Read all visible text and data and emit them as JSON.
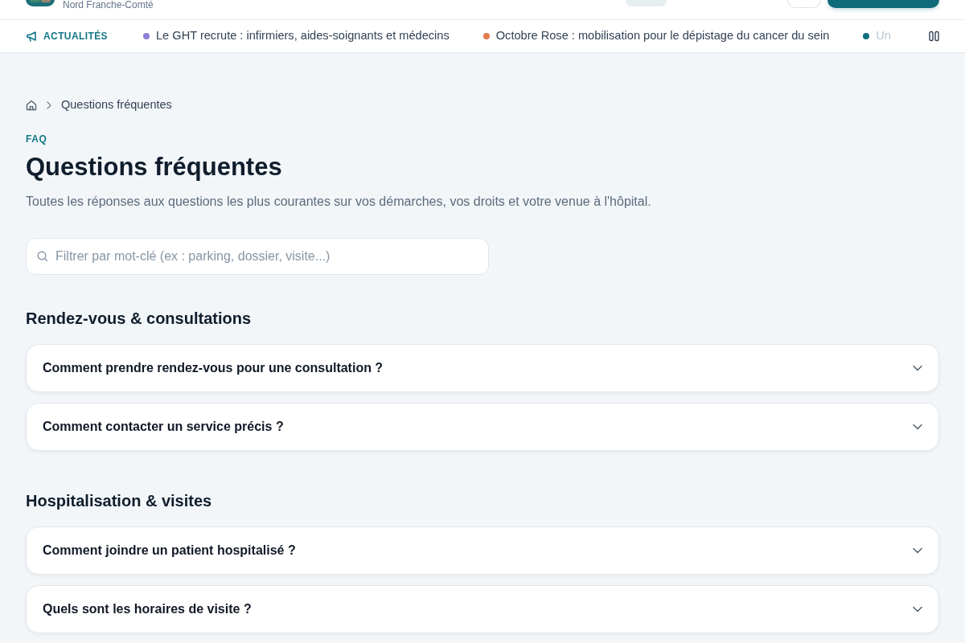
{
  "header": {
    "subtitle": "Nord Franche-Comté"
  },
  "news_ticker": {
    "label": "ACTUALITÉS",
    "items": [
      {
        "text": "Le GHT recrute : infirmiers, aides-soignants et médecins",
        "color": "#8b7fd6"
      },
      {
        "text": "Octobre Rose : mobilisation pour le dépistage du cancer du sein",
        "color": "#e07b4f"
      },
      {
        "text": "Un",
        "color": "#136f7e"
      }
    ]
  },
  "breadcrumb": [
    {
      "label": "Questions fréquentes"
    }
  ],
  "page": {
    "eyebrow": "FAQ",
    "title": "Questions fréquentes",
    "intro": "Toutes les réponses aux questions les plus courantes sur vos démarches, vos droits et votre venue à l'hôpital."
  },
  "search": {
    "placeholder": "Filtrer par mot-clé (ex : parking, dossier, visite...)"
  },
  "sections": [
    {
      "title": "Rendez-vous & consultations",
      "items": [
        {
          "question": "Comment prendre rendez-vous pour une consultation ?",
          "expanded": false
        },
        {
          "question": "Comment contacter un service précis ?",
          "expanded": false
        }
      ]
    },
    {
      "title": "Hospitalisation & visites",
      "items": [
        {
          "question": "Comment joindre un patient hospitalisé ?",
          "expanded": false
        },
        {
          "question": "Quels sont les horaires de visite ?",
          "expanded": false
        }
      ]
    }
  ]
}
